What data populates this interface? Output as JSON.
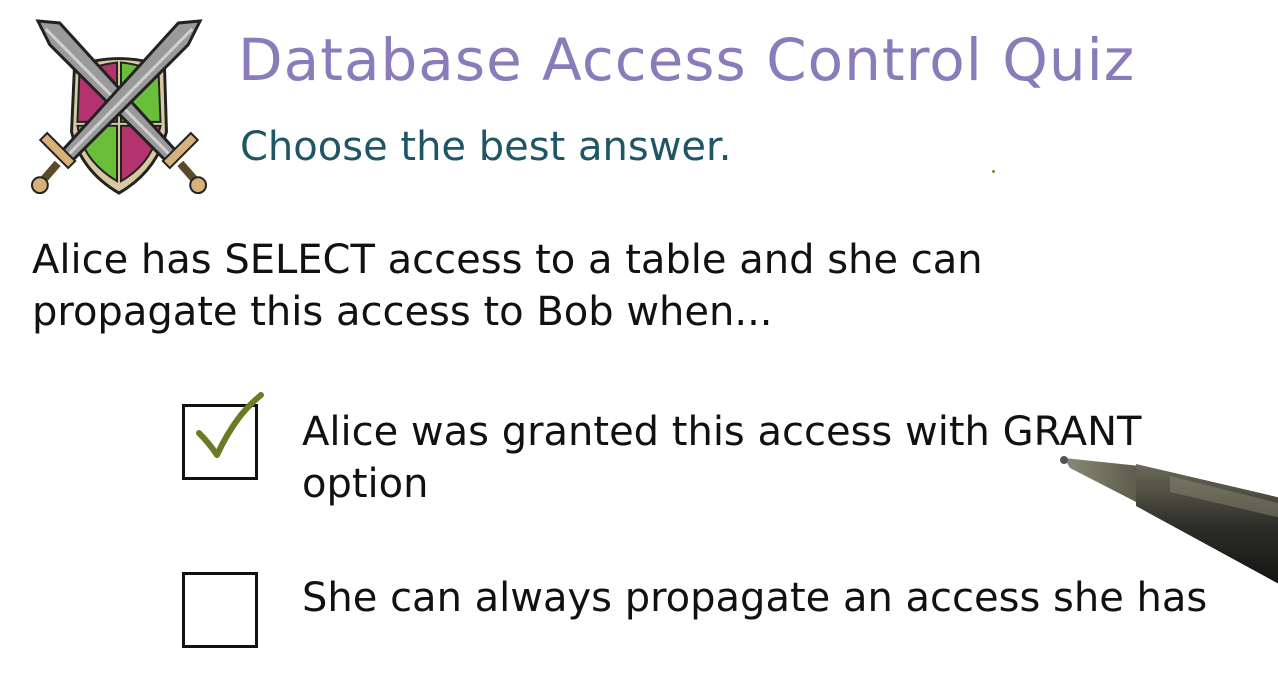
{
  "header": {
    "title": "Database Access Control Quiz",
    "subtitle": "Choose the best answer.",
    "logo_icon": "crossed-swords-shield-icon"
  },
  "question": {
    "text": "Alice has SELECT access to a table and she can propagate this access to Bob when..."
  },
  "options": [
    {
      "label": "Alice was granted this access with GRANT option",
      "checked": true
    },
    {
      "label": "She can always propagate an access she has",
      "checked": false
    }
  ],
  "colors": {
    "title": "#8a7bbb",
    "subtitle": "#1f5666",
    "text": "#111111",
    "checkmark": "#6b7a23",
    "shield_green": "#6abf3a",
    "shield_magenta": "#b3336e",
    "shield_tan": "#d9c8a0",
    "sword_gray": "#8c8c8c"
  }
}
